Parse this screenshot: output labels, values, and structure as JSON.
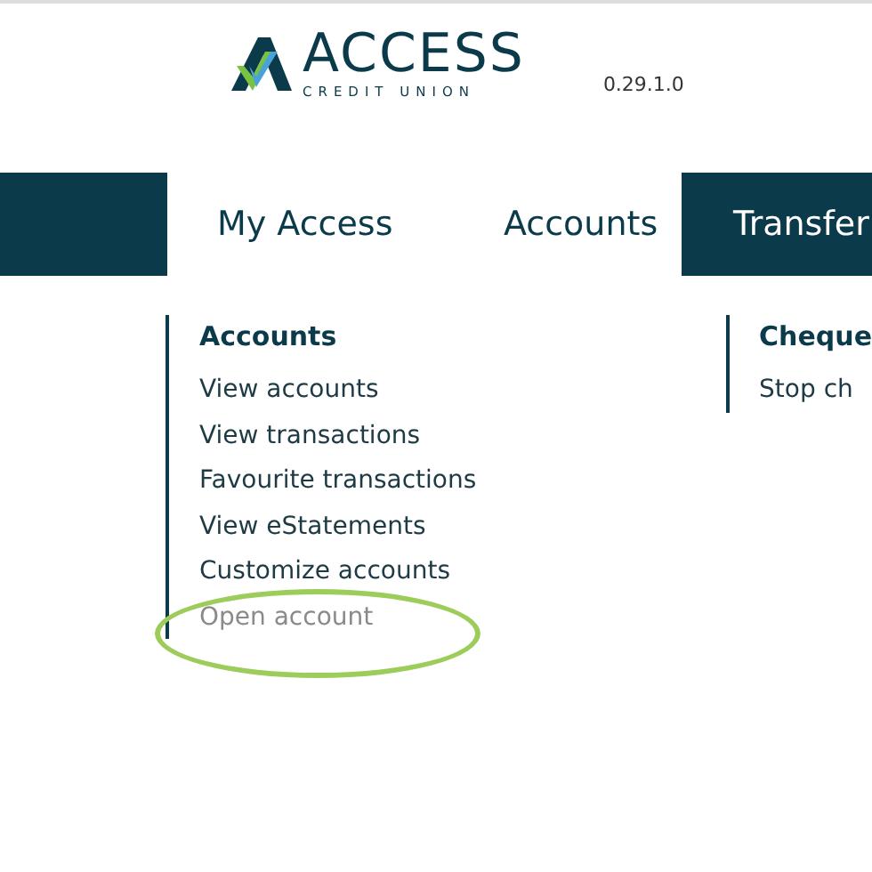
{
  "header": {
    "logo_name": "ACCESS",
    "logo_subtitle": "CREDIT UNION",
    "version": "0.29.1.0"
  },
  "nav": [
    {
      "kind": "dark"
    },
    {
      "label": "My Access",
      "kind": "light"
    },
    {
      "label": "Accounts",
      "kind": "light"
    },
    {
      "label": "Transfer",
      "kind": "dark"
    }
  ],
  "menu_columns": [
    {
      "heading": "Accounts",
      "items": [
        {
          "label": "View accounts",
          "disabled": false,
          "circled": false
        },
        {
          "label": "View transactions",
          "disabled": false,
          "circled": false
        },
        {
          "label": "Favourite transactions",
          "disabled": false,
          "circled": false
        },
        {
          "label": "View eStatements",
          "disabled": false,
          "circled": false
        },
        {
          "label": "Customize accounts",
          "disabled": false,
          "circled": false
        },
        {
          "label": "Open account",
          "disabled": true,
          "circled": true
        }
      ]
    },
    {
      "heading": "Cheque",
      "items": [
        {
          "label": "Stop ch",
          "disabled": false,
          "circled": false
        }
      ]
    }
  ]
}
